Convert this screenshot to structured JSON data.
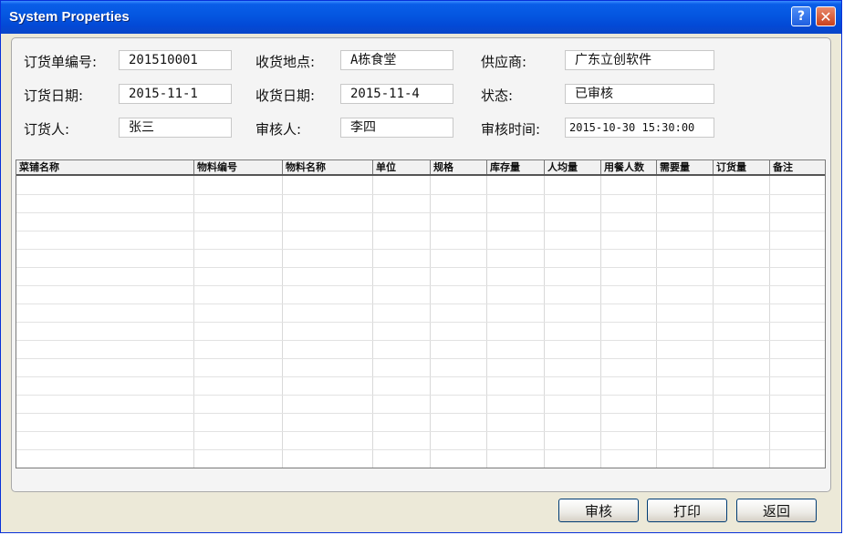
{
  "window": {
    "title": "System Properties",
    "help_glyph": "?",
    "close_glyph": "✕"
  },
  "form": {
    "order_no_label": "订货单编号:",
    "order_no": "201510001",
    "location_label": "收货地点:",
    "location": "A栋食堂",
    "supplier_label": "供应商:",
    "supplier": "广东立创软件",
    "order_date_label": "订货日期:",
    "order_date": "2015-11-1",
    "receive_date_label": "收货日期:",
    "receive_date": "2015-11-4",
    "status_label": "状态:",
    "status": "已审核",
    "orderer_label": "订货人:",
    "orderer": "张三",
    "reviewer_label": "审核人:",
    "reviewer": "李四",
    "review_time_label": "审核时间:",
    "review_time": "2015-10-30 15:30:00"
  },
  "table": {
    "columns": [
      "菜铺名称",
      "物料编号",
      "物料名称",
      "单位",
      "规格",
      "库存量",
      "人均量",
      "用餐人数",
      "需要量",
      "订货量",
      "备注"
    ],
    "rows": []
  },
  "buttons": {
    "review": "审核",
    "print": "打印",
    "back": "返回"
  },
  "colors": {
    "title_bar": "#0456e0",
    "window_bg": "#ece9d8",
    "panel_bg": "#f4f4f4"
  }
}
